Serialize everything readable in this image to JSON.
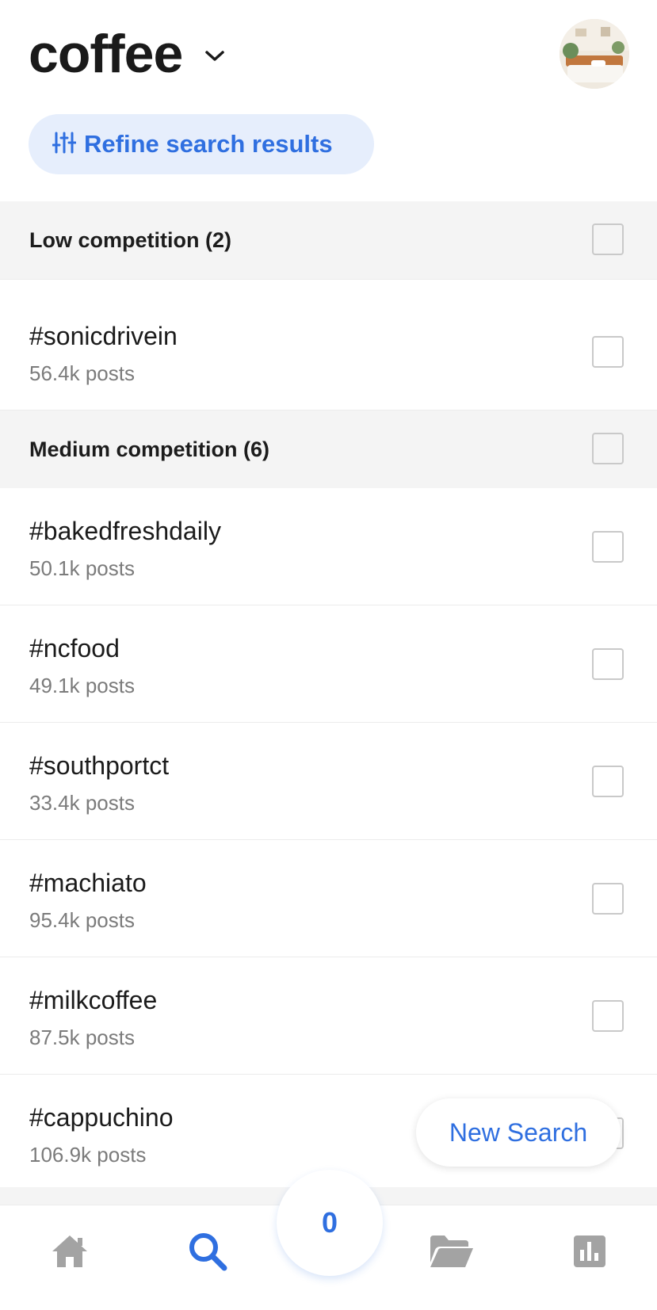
{
  "header": {
    "title": "coffee",
    "refine_label": "Refine search results"
  },
  "sections": [
    {
      "title": "Low competition (2)",
      "items": [
        {
          "tag": "#sonicdrivein",
          "posts": "56.4k posts"
        }
      ]
    },
    {
      "title": "Medium competition (6)",
      "items": [
        {
          "tag": "#bakedfreshdaily",
          "posts": "50.1k posts"
        },
        {
          "tag": "#ncfood",
          "posts": "49.1k posts"
        },
        {
          "tag": "#southportct",
          "posts": "33.4k posts"
        },
        {
          "tag": "#machiato",
          "posts": "95.4k posts"
        },
        {
          "tag": "#milkcoffee",
          "posts": "87.5k posts"
        },
        {
          "tag": "#cappuchino",
          "posts": "106.9k posts"
        }
      ]
    }
  ],
  "floating": {
    "new_search_label": "New Search"
  },
  "bottom_nav": {
    "selected_count": "0",
    "items": [
      {
        "icon": "home-icon"
      },
      {
        "icon": "search-icon",
        "active": true
      },
      {
        "icon": "folder-icon"
      },
      {
        "icon": "stats-icon"
      }
    ]
  },
  "colors": {
    "accent": "#2f6fe0",
    "accent_bg": "#e6eefc",
    "section_bg": "#f4f4f4",
    "muted_text": "#7b7b7b",
    "icon_gray": "#a3a3a3"
  }
}
